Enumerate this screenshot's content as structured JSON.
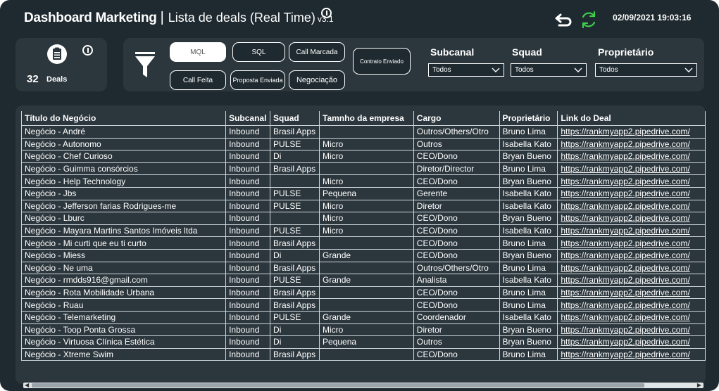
{
  "header": {
    "title_main": "Dashboard Marketing",
    "title_sep": "|",
    "title_sub": "Lista de deals (Real Time)",
    "version": "v3.1",
    "datetime": "02/09/2021 19:03:16"
  },
  "kpi": {
    "value": "32",
    "label": "Deals"
  },
  "filters": {
    "buttons": {
      "mql": "MQL",
      "sql": "SQL",
      "call_marcada": "Call Marcada",
      "contrato_enviado": "Contrato Enviado",
      "call_feita": "Call Feita",
      "proposta_enviada": "Proposta Enviada",
      "negociacao": "Negociação"
    },
    "dropdowns": {
      "subcanal": {
        "label": "Subcanal",
        "value": "Todos"
      },
      "squad": {
        "label": "Squad",
        "value": "Todos"
      },
      "proprietario": {
        "label": "Proprietário",
        "value": "Todos"
      }
    }
  },
  "table": {
    "columns": [
      "Título do Negócio",
      "Subcanal",
      "Squad",
      "Tamnho da empresa",
      "Cargo",
      "Proprietário",
      "Link do Deal"
    ],
    "rows": [
      [
        "Negócio - André",
        "Inbound",
        "Brasil Apps",
        "",
        "Outros/Others/Otro",
        "Bruno Lima",
        "https://rankmyapp2.pipedrive.com/"
      ],
      [
        "Negócio - Autonomo",
        "Inbound",
        "PULSE",
        "Micro",
        "Outros",
        "Isabella Kato",
        "https://rankmyapp2.pipedrive.com/"
      ],
      [
        "Negócio - Chef Curioso",
        "Inbound",
        "Di",
        "Micro",
        "CEO/Dono",
        "Bryan Bueno",
        "https://rankmyapp2.pipedrive.com/"
      ],
      [
        "Negócio - Guimma consórcios",
        "Inbound",
        "Brasil Apps",
        "",
        "Diretor/Director",
        "Bruno Lima",
        "https://rankmyapp2.pipedrive.com/"
      ],
      [
        "Negócio - Help Technology",
        "Inbound",
        "",
        "Micro",
        "CEO/Dono",
        "Bryan Bueno",
        "https://rankmyapp2.pipedrive.com/"
      ],
      [
        "Negócio - Jbs",
        "Inbound",
        "PULSE",
        "Pequena",
        "Gerente",
        "Isabella Kato",
        "https://rankmyapp2.pipedrive.com/"
      ],
      [
        "Negócio - Jefferson farias Rodrigues-me",
        "Inbound",
        "PULSE",
        "Micro",
        "Diretor",
        "Isabella Kato",
        "https://rankmyapp2.pipedrive.com/"
      ],
      [
        "Negócio - Lburc",
        "Inbound",
        "",
        "Micro",
        "CEO/Dono",
        "Bryan Bueno",
        "https://rankmyapp2.pipedrive.com/"
      ],
      [
        "Negócio - Mayara Martins Santos Imóveis ltda",
        "Inbound",
        "PULSE",
        "Micro",
        "CEO/Dono",
        "Isabella Kato",
        "https://rankmyapp2.pipedrive.com/"
      ],
      [
        "Negócio - Mi curti que eu ti curto",
        "Inbound",
        "Brasil Apps",
        "",
        "CEO/Dono",
        "Bruno Lima",
        "https://rankmyapp2.pipedrive.com/"
      ],
      [
        "Negócio - Miess",
        "Inbound",
        "Di",
        "Grande",
        "CEO/Dono",
        "Bryan Bueno",
        "https://rankmyapp2.pipedrive.com/"
      ],
      [
        "Negócio - Ne uma",
        "Inbound",
        "Brasil Apps",
        "",
        "Outros/Others/Otro",
        "Bruno Lima",
        "https://rankmyapp2.pipedrive.com/"
      ],
      [
        "Negócio - rmdds916@gmail.com",
        "Inbound",
        "PULSE",
        "Grande",
        "Analista",
        "Isabella Kato",
        "https://rankmyapp2.pipedrive.com/"
      ],
      [
        "Negócio - Rota Mobilidade Urbana",
        "Inbound",
        "Brasil Apps",
        "",
        "CEO/Dono",
        "Bruno Lima",
        "https://rankmyapp2.pipedrive.com/"
      ],
      [
        "Negócio - Ruau",
        "Inbound",
        "Brasil Apps",
        "",
        "CEO/Dono",
        "Bruno Lima",
        "https://rankmyapp2.pipedrive.com/"
      ],
      [
        "Negócio - Telemarketing",
        "Inbound",
        "PULSE",
        "Grande",
        "Coordenador",
        "Isabella Kato",
        "https://rankmyapp2.pipedrive.com/"
      ],
      [
        "Negócio - Toop Ponta Grossa",
        "Inbound",
        "Di",
        "Micro",
        "Diretor",
        "Bryan Bueno",
        "https://rankmyapp2.pipedrive.com/"
      ],
      [
        "Negócio - Virtuosa Clínica Estética",
        "Inbound",
        "Di",
        "Pequena",
        "Outros",
        "Bryan Bueno",
        "https://rankmyapp2.pipedrive.com/"
      ],
      [
        "Negócio - Xtreme Swim",
        "Inbound",
        "Brasil Apps",
        "",
        "CEO/Dono",
        "Bruno Lima",
        "https://rankmyapp2.pipedrive.com/"
      ]
    ]
  },
  "icons": {
    "info": "info-icon",
    "undo": "undo-arrow-icon",
    "refresh": "refresh-icon",
    "document": "document-icon",
    "filter": "funnel-icon",
    "dropdown": "chevron-down-icon"
  },
  "colors": {
    "background": "#1f2a30",
    "panel": "#2c373d",
    "refresh_accent": "#3ecf4a",
    "text": "#ffffff"
  }
}
